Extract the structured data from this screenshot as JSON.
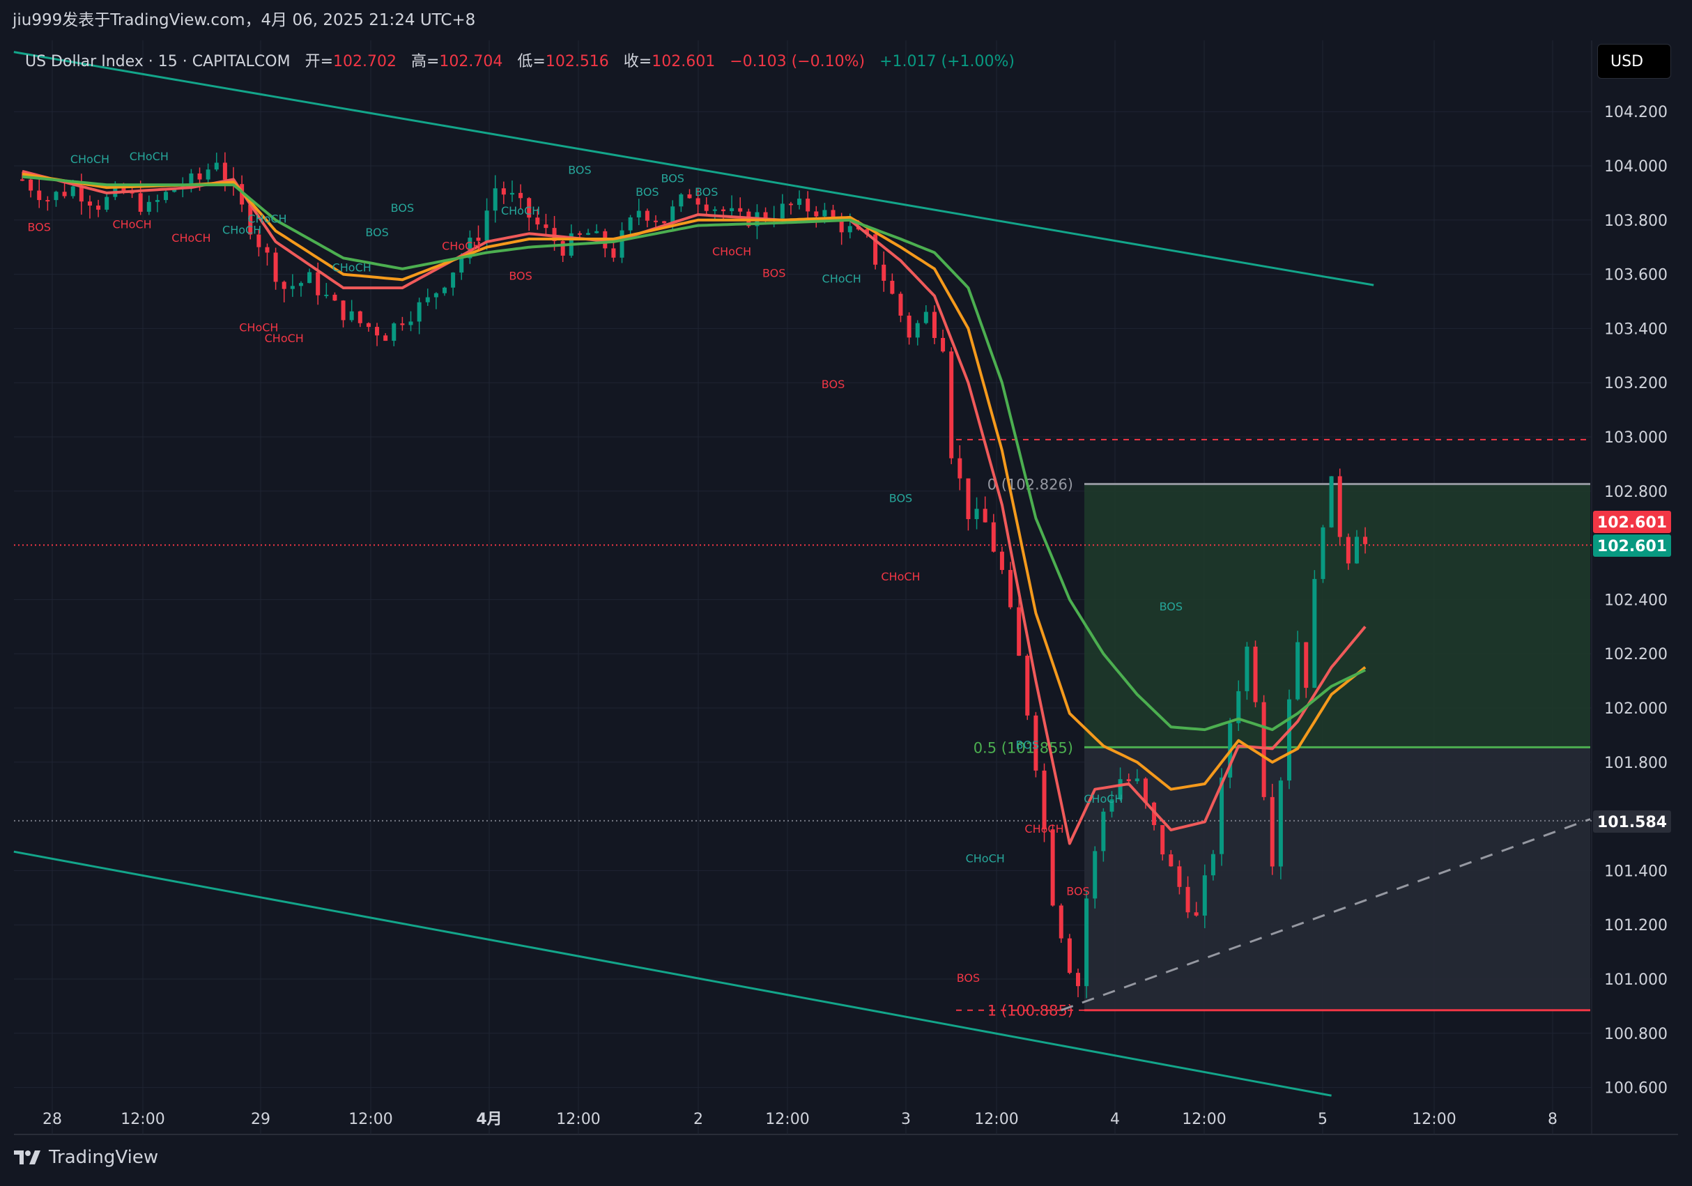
{
  "header": {
    "publish_line": "jiu999发表于TradingView.com，4月 06, 2025 21:24 UTC+8"
  },
  "legend": {
    "symbol": "US Dollar Index · 15 · CAPITALCOM",
    "open_label": "开=",
    "open": "102.702",
    "high_label": "高=",
    "high": "102.704",
    "low_label": "低=",
    "low": "102.516",
    "close_label": "收=",
    "close": "102.601",
    "change": "−0.103 (−0.10%)",
    "change2": "+1.017 (+1.00%)"
  },
  "currency_button": "USD",
  "footer": {
    "brand": "TradingView"
  },
  "colors": {
    "background": "#131722",
    "grid": "#1f2433",
    "up": "#089981",
    "down": "#f23645",
    "ma_red": "#f05a5a",
    "ma_orange": "#f59a1c",
    "ma_green": "#4caf50",
    "channel": "#13a58a",
    "fib_zone_green": "#1f3b2a",
    "fib_zone_gray": "#262a35"
  },
  "chart_data": {
    "type": "candlestick",
    "symbol": "US Dollar Index",
    "timeframe": "15",
    "ylim": [
      100.52,
      104.36
    ],
    "y_ticks": [
      "104.200",
      "104.000",
      "103.800",
      "103.600",
      "103.400",
      "103.200",
      "103.000",
      "102.800",
      "102.400",
      "102.200",
      "102.000",
      "101.800",
      "101.400",
      "101.200",
      "101.000",
      "100.800",
      "100.600"
    ],
    "x_ticks": [
      "28",
      "12:00",
      "29",
      "12:00",
      "4月",
      "12:00",
      "2",
      "12:00",
      "3",
      "12:00",
      "4",
      "12:00",
      "5",
      "12:00",
      "8"
    ],
    "price_tags": [
      {
        "label": "102.601",
        "value": 102.601,
        "color": "#f23645"
      },
      {
        "label": "102.601",
        "value": 102.601,
        "color": "#089981"
      },
      {
        "label": "101.584",
        "value": 101.584,
        "color": "#2a2e39"
      }
    ],
    "price_path": [
      [
        0,
        103.95
      ],
      [
        3,
        103.88
      ],
      [
        6,
        103.92
      ],
      [
        9,
        103.86
      ],
      [
        12,
        103.9
      ],
      [
        15,
        103.84
      ],
      [
        18,
        103.92
      ],
      [
        21,
        103.95
      ],
      [
        23,
        104.03
      ],
      [
        25,
        103.9
      ],
      [
        28,
        103.72
      ],
      [
        31,
        103.55
      ],
      [
        34,
        103.58
      ],
      [
        37,
        103.48
      ],
      [
        40,
        103.42
      ],
      [
        43,
        103.38
      ],
      [
        45,
        103.44
      ],
      [
        48,
        103.5
      ],
      [
        51,
        103.62
      ],
      [
        54,
        103.75
      ],
      [
        56,
        103.92
      ],
      [
        58,
        103.88
      ],
      [
        61,
        103.78
      ],
      [
        64,
        103.7
      ],
      [
        67,
        103.75
      ],
      [
        70,
        103.68
      ],
      [
        73,
        103.84
      ],
      [
        76,
        103.8
      ],
      [
        79,
        103.9
      ],
      [
        82,
        103.85
      ],
      [
        85,
        103.8
      ],
      [
        88,
        103.82
      ],
      [
        91,
        103.85
      ],
      [
        94,
        103.84
      ],
      [
        97,
        103.78
      ],
      [
        100,
        103.72
      ],
      [
        103,
        103.52
      ],
      [
        105,
        103.38
      ],
      [
        107,
        103.45
      ],
      [
        109,
        103.35
      ],
      [
        110,
        102.95
      ],
      [
        112,
        102.72
      ],
      [
        114,
        102.68
      ],
      [
        116,
        102.5
      ],
      [
        118,
        102.18
      ],
      [
        120,
        101.8
      ],
      [
        122,
        101.3
      ],
      [
        124,
        101.05
      ],
      [
        125,
        100.98
      ],
      [
        126,
        101.3
      ],
      [
        128,
        101.62
      ],
      [
        130,
        101.74
      ],
      [
        132,
        101.72
      ],
      [
        134,
        101.55
      ],
      [
        136,
        101.4
      ],
      [
        138,
        101.28
      ],
      [
        139,
        101.22
      ],
      [
        141,
        101.48
      ],
      [
        143,
        101.95
      ],
      [
        145,
        102.22
      ],
      [
        146,
        102.05
      ],
      [
        147,
        101.7
      ],
      [
        148,
        101.45
      ],
      [
        149,
        101.75
      ],
      [
        150,
        102.05
      ],
      [
        151,
        102.25
      ],
      [
        152,
        102.1
      ],
      [
        153,
        102.45
      ],
      [
        154,
        102.7
      ],
      [
        155,
        102.82
      ],
      [
        156,
        102.65
      ],
      [
        157,
        102.56
      ],
      [
        158,
        102.66
      ],
      [
        159,
        102.6
      ]
    ],
    "bar_count": 160,
    "moving_averages": [
      {
        "color": "#f05a5a",
        "path": [
          [
            0,
            103.98
          ],
          [
            10,
            103.9
          ],
          [
            20,
            103.92
          ],
          [
            25,
            103.95
          ],
          [
            30,
            103.72
          ],
          [
            38,
            103.55
          ],
          [
            45,
            103.55
          ],
          [
            55,
            103.72
          ],
          [
            60,
            103.75
          ],
          [
            70,
            103.72
          ],
          [
            80,
            103.82
          ],
          [
            90,
            103.8
          ],
          [
            98,
            103.8
          ],
          [
            104,
            103.65
          ],
          [
            108,
            103.52
          ],
          [
            112,
            103.2
          ],
          [
            116,
            102.75
          ],
          [
            120,
            102.1
          ],
          [
            124,
            101.5
          ],
          [
            127,
            101.7
          ],
          [
            131,
            101.72
          ],
          [
            136,
            101.55
          ],
          [
            140,
            101.58
          ],
          [
            144,
            101.86
          ],
          [
            148,
            101.85
          ],
          [
            151,
            101.95
          ],
          [
            155,
            102.15
          ],
          [
            159,
            102.3
          ]
        ]
      },
      {
        "color": "#f59a1c",
        "path": [
          [
            0,
            103.97
          ],
          [
            10,
            103.92
          ],
          [
            20,
            103.93
          ],
          [
            25,
            103.94
          ],
          [
            30,
            103.76
          ],
          [
            38,
            103.6
          ],
          [
            45,
            103.58
          ],
          [
            55,
            103.7
          ],
          [
            60,
            103.73
          ],
          [
            70,
            103.73
          ],
          [
            80,
            103.8
          ],
          [
            90,
            103.8
          ],
          [
            98,
            103.81
          ],
          [
            104,
            103.7
          ],
          [
            108,
            103.62
          ],
          [
            112,
            103.4
          ],
          [
            116,
            102.95
          ],
          [
            120,
            102.35
          ],
          [
            124,
            101.98
          ],
          [
            128,
            101.86
          ],
          [
            132,
            101.8
          ],
          [
            136,
            101.7
          ],
          [
            140,
            101.72
          ],
          [
            144,
            101.88
          ],
          [
            148,
            101.8
          ],
          [
            151,
            101.85
          ],
          [
            155,
            102.05
          ],
          [
            159,
            102.15
          ]
        ]
      },
      {
        "color": "#4caf50",
        "path": [
          [
            0,
            103.96
          ],
          [
            10,
            103.93
          ],
          [
            20,
            103.93
          ],
          [
            25,
            103.93
          ],
          [
            30,
            103.8
          ],
          [
            38,
            103.66
          ],
          [
            45,
            103.62
          ],
          [
            55,
            103.68
          ],
          [
            60,
            103.7
          ],
          [
            70,
            103.72
          ],
          [
            80,
            103.78
          ],
          [
            90,
            103.79
          ],
          [
            98,
            103.8
          ],
          [
            104,
            103.73
          ],
          [
            108,
            103.68
          ],
          [
            112,
            103.55
          ],
          [
            116,
            103.2
          ],
          [
            120,
            102.7
          ],
          [
            124,
            102.4
          ],
          [
            128,
            102.2
          ],
          [
            132,
            102.05
          ],
          [
            136,
            101.93
          ],
          [
            140,
            101.92
          ],
          [
            144,
            101.96
          ],
          [
            148,
            101.92
          ],
          [
            151,
            101.98
          ],
          [
            155,
            102.08
          ],
          [
            159,
            102.14
          ]
        ]
      }
    ],
    "channel": {
      "upper": [
        [
          -1,
          104.42
        ],
        [
          160,
          103.56
        ]
      ],
      "lower": [
        [
          -1,
          101.47
        ],
        [
          155,
          100.57
        ]
      ]
    },
    "fibonacci": [
      {
        "label": "0 (102.826)",
        "value": 102.826,
        "color": "#9598a1"
      },
      {
        "label": "0.5 (101.855)",
        "value": 101.855,
        "color": "#4caf50"
      },
      {
        "label": "1 (100.885)",
        "value": 100.885,
        "color": "#f23645"
      }
    ],
    "levels": [
      {
        "value": 102.99,
        "style": "dashed",
        "color": "#f23645"
      },
      {
        "value": 102.601,
        "style": "dotted",
        "color": "#f23645"
      },
      {
        "value": 101.584,
        "style": "dotted",
        "color": "#787b86"
      }
    ],
    "trendline_dashed": [
      [
        123,
        100.885
      ],
      [
        160,
        101.59
      ]
    ],
    "annotations": [
      {
        "text": "BOS",
        "x": 2,
        "y": 103.76,
        "color": "#f23645"
      },
      {
        "text": "CHoCH",
        "x": 8,
        "y": 104.01,
        "color": "#26a69a"
      },
      {
        "text": "CHoCH",
        "x": 15,
        "y": 104.02,
        "color": "#26a69a"
      },
      {
        "text": "CHoCH",
        "x": 13,
        "y": 103.77,
        "color": "#f23645"
      },
      {
        "text": "CHoCH",
        "x": 20,
        "y": 103.72,
        "color": "#f23645"
      },
      {
        "text": "CHoCH",
        "x": 26,
        "y": 103.75,
        "color": "#26a69a"
      },
      {
        "text": "CHoCH",
        "x": 29,
        "y": 103.79,
        "color": "#26a69a"
      },
      {
        "text": "CHoCH",
        "x": 28,
        "y": 103.39,
        "color": "#f23645"
      },
      {
        "text": "CHoCH",
        "x": 31,
        "y": 103.35,
        "color": "#f23645"
      },
      {
        "text": "CHoCH",
        "x": 39,
        "y": 103.61,
        "color": "#26a69a"
      },
      {
        "text": "BOS",
        "x": 42,
        "y": 103.74,
        "color": "#26a69a"
      },
      {
        "text": "BOS",
        "x": 45,
        "y": 103.83,
        "color": "#26a69a"
      },
      {
        "text": "CHoCH",
        "x": 52,
        "y": 103.69,
        "color": "#f23645"
      },
      {
        "text": "CHoCH",
        "x": 59,
        "y": 103.82,
        "color": "#26a69a"
      },
      {
        "text": "BOS",
        "x": 59,
        "y": 103.58,
        "color": "#f23645"
      },
      {
        "text": "BOS",
        "x": 66,
        "y": 103.97,
        "color": "#26a69a"
      },
      {
        "text": "BOS",
        "x": 74,
        "y": 103.89,
        "color": "#26a69a"
      },
      {
        "text": "BOS",
        "x": 77,
        "y": 103.94,
        "color": "#26a69a"
      },
      {
        "text": "BOS",
        "x": 81,
        "y": 103.89,
        "color": "#26a69a"
      },
      {
        "text": "CHoCH",
        "x": 84,
        "y": 103.67,
        "color": "#f23645"
      },
      {
        "text": "BOS",
        "x": 89,
        "y": 103.59,
        "color": "#f23645"
      },
      {
        "text": "CHoCH",
        "x": 97,
        "y": 103.57,
        "color": "#26a69a"
      },
      {
        "text": "BOS",
        "x": 96,
        "y": 103.18,
        "color": "#f23645"
      },
      {
        "text": "BOS",
        "x": 104,
        "y": 102.76,
        "color": "#26a69a"
      },
      {
        "text": "CHoCH",
        "x": 104,
        "y": 102.47,
        "color": "#f23645"
      },
      {
        "text": "BOS",
        "x": 112,
        "y": 100.99,
        "color": "#f23645"
      },
      {
        "text": "CHoCH",
        "x": 114,
        "y": 101.43,
        "color": "#26a69a"
      },
      {
        "text": "BOS",
        "x": 119,
        "y": 101.85,
        "color": "#26a69a"
      },
      {
        "text": "CHoCH",
        "x": 121,
        "y": 101.54,
        "color": "#f23645"
      },
      {
        "text": "CHoCH",
        "x": 128,
        "y": 101.65,
        "color": "#26a69a"
      },
      {
        "text": "BOS",
        "x": 125,
        "y": 101.31,
        "color": "#f23645"
      },
      {
        "text": "BOS",
        "x": 136,
        "y": 102.36,
        "color": "#26a69a"
      }
    ]
  }
}
